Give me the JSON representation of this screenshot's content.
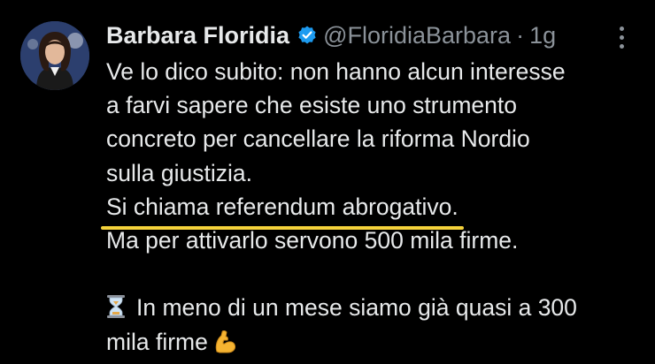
{
  "post": {
    "author": {
      "name": "Barbara Floridia",
      "handle": "@FloridiaBarbara",
      "verified": true,
      "avatar_icon": "profile-photo"
    },
    "separator": "·",
    "time": "1g",
    "menu_icon": "more-vertical-icon",
    "lines": [
      "Ve lo dico subito: non hanno alcun interesse",
      "a farvi sapere che esiste uno strumento",
      "concreto per cancellare la riforma Nordio",
      "sulla giustizia.",
      "Si chiama referendum abrogativo.",
      "Ma per attivarlo servono 500 mila firme.",
      "",
      "In meno di un mese siamo già quasi a 300",
      "mila firme"
    ],
    "emoji": {
      "hourglass": "hourglass-icon",
      "muscle": "flexed-biceps-icon"
    },
    "colors": {
      "background": "#000000",
      "text": "#e7e9ea",
      "secondary": "#8b9299",
      "verified": "#1d9bf0",
      "underline": "#f4d23b"
    }
  }
}
